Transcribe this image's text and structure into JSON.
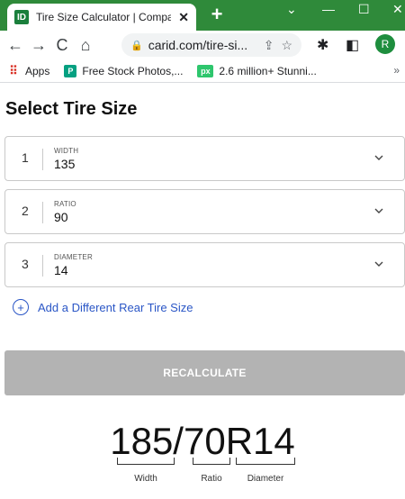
{
  "browser": {
    "tab_title": "Tire Size Calculator | Comparis",
    "tab_favicon": "ID",
    "new_tab_label": "+",
    "url": "carid.com/tire-si...",
    "profile_initial": "R",
    "bookmarks": [
      {
        "label": "Apps",
        "icon": "apps-grid-icon"
      },
      {
        "label": "Free Stock Photos,...",
        "icon": "pexels-icon"
      },
      {
        "label": "2.6 million+ Stunni...",
        "icon": "pixabay-icon"
      }
    ]
  },
  "page": {
    "title": "Select Tire Size",
    "selects": [
      {
        "index": "1",
        "caption": "WIDTH",
        "value": "135"
      },
      {
        "index": "2",
        "caption": "RATIO",
        "value": "90"
      },
      {
        "index": "3",
        "caption": "DIAMETER",
        "value": "14"
      }
    ],
    "add_rear_label": "Add a Different Rear Tire Size",
    "recalculate_label": "RECALCULATE",
    "result": {
      "size": "185/70R14",
      "labels": {
        "width": "Width",
        "ratio": "Ratio",
        "diameter": "Diameter"
      }
    }
  },
  "colors": {
    "tab_strip": "#2f8a3a",
    "link": "#2a56c6",
    "button_disabled": "#b3b3b3"
  }
}
